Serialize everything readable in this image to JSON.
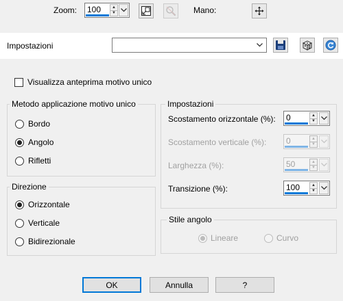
{
  "toolbar": {
    "zoom_label": "Zoom:",
    "zoom_value": "100",
    "mano_label": "Mano:"
  },
  "presets": {
    "label": "Impostazioni",
    "value": ""
  },
  "preview_checkbox": {
    "label": "Visualizza anteprima motivo unico",
    "checked": false
  },
  "method_group": {
    "title": "Metodo applicazione motivo unico",
    "options": [
      {
        "label": "Bordo",
        "checked": false
      },
      {
        "label": "Angolo",
        "checked": true
      },
      {
        "label": "Rifletti",
        "checked": false
      }
    ]
  },
  "direction_group": {
    "title": "Direzione",
    "options": [
      {
        "label": "Orizzontale",
        "checked": true
      },
      {
        "label": "Verticale",
        "checked": false
      },
      {
        "label": "Bidirezionale",
        "checked": false
      }
    ]
  },
  "settings_group": {
    "title": "Impostazioni",
    "fields": [
      {
        "label": "Scostamento orizzontale (%):",
        "value": "0",
        "enabled": true
      },
      {
        "label": "Scostamento verticale (%):",
        "value": "0",
        "enabled": false
      },
      {
        "label": "Larghezza (%):",
        "value": "50",
        "enabled": false
      },
      {
        "label": "Transizione (%):",
        "value": "100",
        "enabled": true
      }
    ]
  },
  "corner_style_group": {
    "title": "Stile angolo",
    "options": [
      {
        "label": "Lineare",
        "checked": true,
        "enabled": false
      },
      {
        "label": "Curvo",
        "checked": false,
        "enabled": false
      }
    ]
  },
  "buttons": {
    "ok": "OK",
    "cancel": "Annulla",
    "help": "?"
  },
  "colors": {
    "accent": "#0078d7",
    "background": "#f0f0f0"
  },
  "icons": [
    "proof-toggle-icon",
    "reset-zoom-icon",
    "pan-icon",
    "save-preset-icon",
    "randomize-dice-icon",
    "reset-icon",
    "chevron-down-icon"
  ]
}
